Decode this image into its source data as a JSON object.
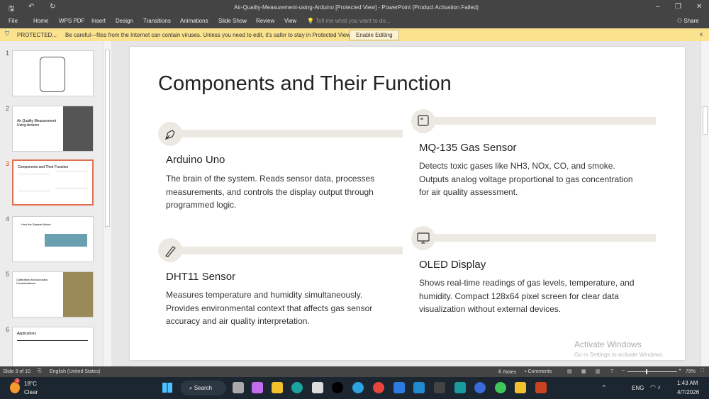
{
  "window": {
    "title": "Air-Quality-Measurement-using-Arduino [Protected View] - PowerPoint (Product Activation Failed)",
    "share": "Share"
  },
  "ribbon": {
    "tabs": [
      "File",
      "Home",
      "WPS PDF",
      "Insert",
      "Design",
      "Transitions",
      "Animations",
      "Slide Show",
      "Review",
      "View"
    ],
    "tell_me": "Tell me what you want to do..."
  },
  "protected": {
    "label": "PROTECTED...",
    "message": "Be careful—files from the Internet can contain viruses. Unless you need to edit, it's safer to stay in Protected View.",
    "button": "Enable Editing",
    "close": "x"
  },
  "thumbnails": [
    {
      "num": "1"
    },
    {
      "num": "2",
      "title": "Air Quality Measurement Using Arduino"
    },
    {
      "num": "3",
      "title": "Components and Their Function"
    },
    {
      "num": "4",
      "title": "How the System Works"
    },
    {
      "num": "5",
      "title": "Calibration and Accuracy Considerations"
    },
    {
      "num": "6",
      "title": "Applications"
    }
  ],
  "slide": {
    "title": "Components and Their Function",
    "cards": [
      {
        "icon": "pen-nib-icon",
        "heading": "Arduino Uno",
        "body": "The brain of the system. Reads sensor data, processes measurements, and controls the display output through programmed logic."
      },
      {
        "icon": "sensor-icon",
        "heading": "MQ-135 Gas Sensor",
        "body": "Detects toxic gases like NH3, NOx, CO, and smoke. Outputs analog voltage proportional to gas concentration for air quality assessment."
      },
      {
        "icon": "thermometer-icon",
        "heading": "DHT11 Sensor",
        "body": "Measures temperature and humidity simultaneously. Provides environmental context that affects gas sensor accuracy and air quality interpretation."
      },
      {
        "icon": "monitor-icon",
        "heading": "OLED Display",
        "body": "Shows real-time readings of gas levels, temperature, and humidity. Compact 128x64 pixel screen for clear data visualization without external devices."
      }
    ]
  },
  "watermark": {
    "line1": "Activate Windows",
    "line2": "Go to Settings to activate Windows."
  },
  "status": {
    "slide": "Slide 3 of 10",
    "language": "English (United States)",
    "notes": "Notes",
    "comments": "Comments",
    "zoom": "79%"
  },
  "taskbar": {
    "temp": "18°C",
    "weather": "Clear",
    "badge": "3",
    "search": "Search",
    "lang": "ENG",
    "time": "1:43 AM",
    "date": "4/7/2026"
  }
}
